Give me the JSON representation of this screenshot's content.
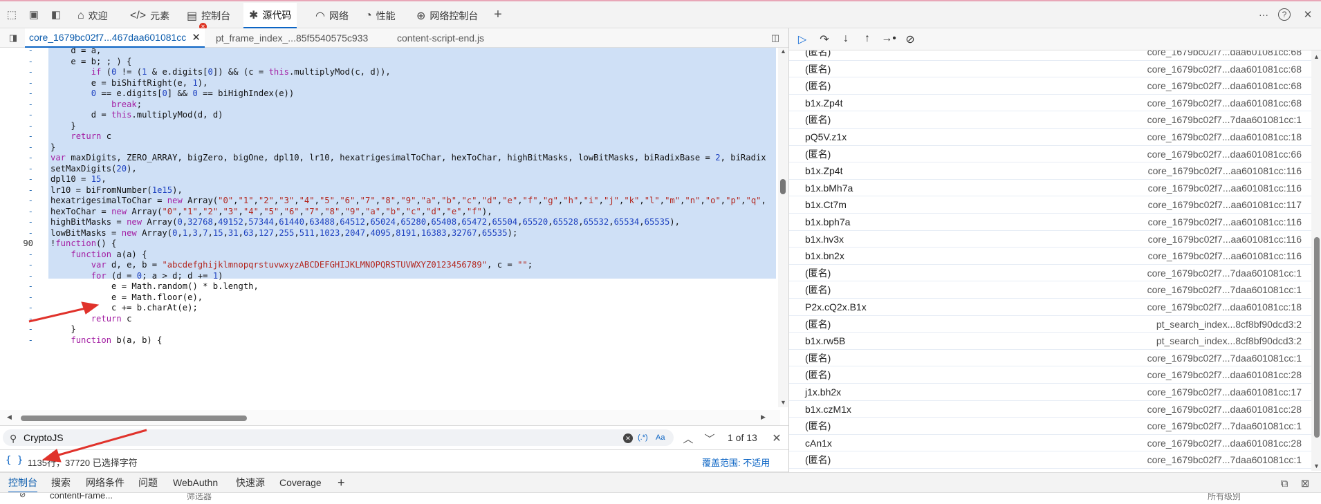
{
  "toolbar": {
    "tabs": [
      {
        "label": "欢迎",
        "icon": "home-icon"
      },
      {
        "label": "元素",
        "icon": "code-icon"
      },
      {
        "label": "控制台",
        "icon": "console-icon"
      },
      {
        "label": "源代码",
        "icon": "bug-icon"
      },
      {
        "label": "网络",
        "icon": "wifi-icon"
      },
      {
        "label": "性能",
        "icon": "gauge-icon"
      },
      {
        "label": "网络控制台",
        "icon": "network-console-icon"
      }
    ],
    "add_tab": "+",
    "more": "···",
    "help": "?",
    "close": "✕"
  },
  "file_tabs": [
    {
      "label": "core_1679bc02f7...467daa601081cc",
      "active": true
    },
    {
      "label": "pt_frame_index_...85f5540575c933",
      "active": false
    },
    {
      "label": "content-script-end.js",
      "active": false
    }
  ],
  "code": {
    "lines": [
      {
        "gutter": "-",
        "text": "    d = a,",
        "selected": true
      },
      {
        "gutter": "-",
        "text": "    e = b; ; ) {",
        "selected": true
      },
      {
        "gutter": "-",
        "text": "        if (0 != (1 & e.digits[0]) && (c = this.multiplyMod(c, d)),",
        "selected": true
      },
      {
        "gutter": "-",
        "text": "        e = biShiftRight(e, 1),",
        "selected": true
      },
      {
        "gutter": "-",
        "text": "        0 == e.digits[0] && 0 == biHighIndex(e))",
        "selected": true
      },
      {
        "gutter": "-",
        "text": "            break;",
        "selected": true
      },
      {
        "gutter": "-",
        "text": "        d = this.multiplyMod(d, d)",
        "selected": true
      },
      {
        "gutter": "-",
        "text": "    }",
        "selected": true
      },
      {
        "gutter": "-",
        "text": "    return c",
        "selected": true
      },
      {
        "gutter": "-",
        "text": "}",
        "selected": true
      },
      {
        "gutter": "-",
        "text": "var maxDigits, ZERO_ARRAY, bigZero, bigOne, dpl10, lr10, hexatrigesimalToChar, hexToChar, highBitMasks, lowBitMasks, biRadixBase = 2, biRadix",
        "selected": true
      },
      {
        "gutter": "-",
        "text": "setMaxDigits(20),",
        "selected": true
      },
      {
        "gutter": "-",
        "text": "dpl10 = 15,",
        "selected": true
      },
      {
        "gutter": "-",
        "text": "lr10 = biFromNumber(1e15),",
        "selected": true
      },
      {
        "gutter": "-",
        "text": "hexatrigesimalToChar = new Array(\"0\",\"1\",\"2\",\"3\",\"4\",\"5\",\"6\",\"7\",\"8\",\"9\",\"a\",\"b\",\"c\",\"d\",\"e\",\"f\",\"g\",\"h\",\"i\",\"j\",\"k\",\"l\",\"m\",\"n\",\"o\",\"p\",\"q\",",
        "selected": true
      },
      {
        "gutter": "-",
        "text": "hexToChar = new Array(\"0\",\"1\",\"2\",\"3\",\"4\",\"5\",\"6\",\"7\",\"8\",\"9\",\"a\",\"b\",\"c\",\"d\",\"e\",\"f\"),",
        "selected": true
      },
      {
        "gutter": "-",
        "text": "highBitMasks = new Array(0,32768,49152,57344,61440,63488,64512,65024,65280,65408,65472,65504,65520,65528,65532,65534,65535),",
        "selected": true
      },
      {
        "gutter": "-",
        "text": "lowBitMasks = new Array(0,1,3,7,15,31,63,127,255,511,1023,2047,4095,8191,16383,32767,65535);",
        "selected": true
      },
      {
        "gutter": "90",
        "text": "!function() {",
        "selected": false
      },
      {
        "gutter": "-",
        "text": "    function a(a) {",
        "selected": false
      },
      {
        "gutter": "-",
        "text": "        var d, e, b = \"abcdefghijklmnopqrstuvwxyzABCDEFGHIJKLMNOPQRSTUVWXYZ0123456789\", c = \"\";",
        "selected": false
      },
      {
        "gutter": "-",
        "text": "        for (d = 0; a > d; d += 1)",
        "selected": false
      },
      {
        "gutter": "-",
        "text": "            e = Math.random() * b.length,",
        "selected": false
      },
      {
        "gutter": "-",
        "text": "            e = Math.floor(e),",
        "selected": false
      },
      {
        "gutter": "-",
        "text": "            c += b.charAt(e);",
        "selected": false
      },
      {
        "gutter": "-",
        "text": "        return c",
        "selected": false
      },
      {
        "gutter": "-",
        "text": "    }",
        "selected": false
      },
      {
        "gutter": "-",
        "text": "    function b(a, b) {",
        "selected": false
      }
    ]
  },
  "search": {
    "value": "CryptoJS",
    "regex_label": "(.*)",
    "case_label": "Aa",
    "match_count": "1 of 13"
  },
  "status": {
    "braces": "{ }",
    "selection": "1135行，37720 已选择字符",
    "coverage": "覆盖范围: 不适用"
  },
  "call_stack": [
    {
      "name": "(匿名)",
      "location": "core_1679bc02f7...daa601081cc:68"
    },
    {
      "name": "(匿名)",
      "location": "core_1679bc02f7...daa601081cc:68"
    },
    {
      "name": "(匿名)",
      "location": "core_1679bc02f7...daa601081cc:68"
    },
    {
      "name": "b1x.Zp4t",
      "location": "core_1679bc02f7...daa601081cc:68"
    },
    {
      "name": "(匿名)",
      "location": "core_1679bc02f7...7daa601081cc:1"
    },
    {
      "name": "pQ5V.z1x",
      "location": "core_1679bc02f7...daa601081cc:18"
    },
    {
      "name": "(匿名)",
      "location": "core_1679bc02f7...daa601081cc:66"
    },
    {
      "name": "b1x.Zp4t",
      "location": "core_1679bc02f7...aa601081cc:116"
    },
    {
      "name": "b1x.bMh7a",
      "location": "core_1679bc02f7...aa601081cc:116"
    },
    {
      "name": "b1x.Ct7m",
      "location": "core_1679bc02f7...aa601081cc:117"
    },
    {
      "name": "b1x.bph7a",
      "location": "core_1679bc02f7...aa601081cc:116"
    },
    {
      "name": "b1x.hv3x",
      "location": "core_1679bc02f7...aa601081cc:116"
    },
    {
      "name": "b1x.bn2x",
      "location": "core_1679bc02f7...aa601081cc:116"
    },
    {
      "name": "(匿名)",
      "location": "core_1679bc02f7...7daa601081cc:1"
    },
    {
      "name": "(匿名)",
      "location": "core_1679bc02f7...7daa601081cc:1"
    },
    {
      "name": "P2x.cQ2x.B1x",
      "location": "core_1679bc02f7...daa601081cc:18"
    },
    {
      "name": "(匿名)",
      "location": "pt_search_index...8cf8bf90dcd3:2"
    },
    {
      "name": "b1x.rw5B",
      "location": "pt_search_index...8cf8bf90dcd3:2"
    },
    {
      "name": "(匿名)",
      "location": "core_1679bc02f7...7daa601081cc:1"
    },
    {
      "name": "(匿名)",
      "location": "core_1679bc02f7...daa601081cc:28"
    },
    {
      "name": "j1x.bh2x",
      "location": "core_1679bc02f7...daa601081cc:17"
    },
    {
      "name": "b1x.czM1x",
      "location": "core_1679bc02f7...daa601081cc:28"
    },
    {
      "name": "(匿名)",
      "location": "core_1679bc02f7...7daa601081cc:1"
    },
    {
      "name": "cAn1x",
      "location": "core_1679bc02f7...daa601081cc:28"
    },
    {
      "name": "(匿名)",
      "location": "core_1679bc02f7...7daa601081cc:1"
    }
  ],
  "drawer": {
    "tabs": [
      "控制台",
      "搜索",
      "网络条件",
      "问题",
      "WebAuthn",
      "快速源",
      "Coverage"
    ],
    "add": "+",
    "context": "contentFrame...",
    "filter": "筛选器",
    "levels": "所有级别"
  },
  "colors": {
    "accent": "#0b64c4",
    "selection": "#cfe0f6",
    "annotation": "#e0322b"
  }
}
